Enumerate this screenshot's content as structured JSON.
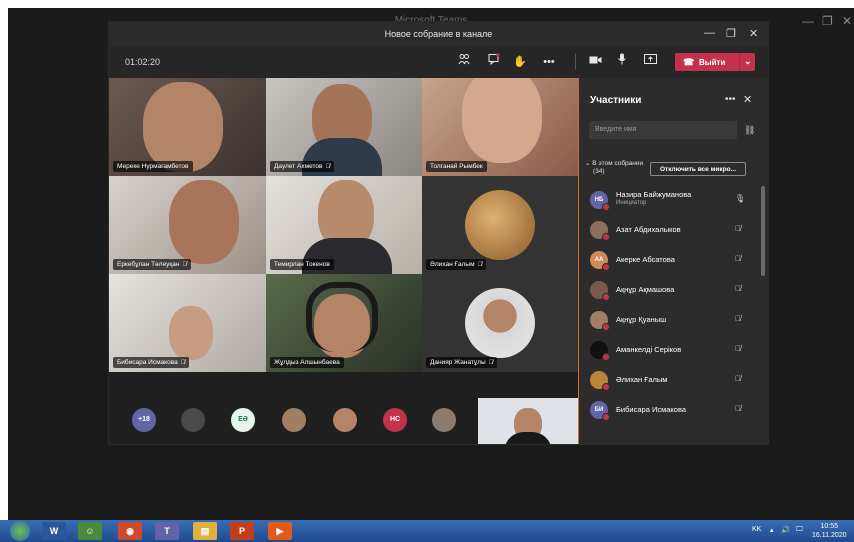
{
  "outer": {
    "title": "Microsoft Teams"
  },
  "window": {
    "title": "Новое собрание в канале"
  },
  "toolbar": {
    "timer": "01:02:20",
    "leave_label": "Выйти"
  },
  "video_tiles": [
    {
      "name": "Мереке Нурмагамбетов",
      "muted": false
    },
    {
      "name": "Даулет Ахметов",
      "muted": true
    },
    {
      "name": "Толганай Рымбек",
      "muted": false
    },
    {
      "name": "Еркебұлан Төлеуқан",
      "muted": true
    },
    {
      "name": "Темирлан Токенов",
      "muted": false
    },
    {
      "name": "Әлихан Ғалым",
      "muted": true
    },
    {
      "name": "Бибисара Исмакова",
      "muted": true
    },
    {
      "name": "Жұлдыз Алшынбаева",
      "muted": false
    },
    {
      "name": "Данияр Жанатұлы",
      "muted": true
    }
  ],
  "strip": {
    "more_count": "+18",
    "initials_eo": "ЕӘ",
    "initials_hc": "НС"
  },
  "panel": {
    "title": "Участники",
    "search_placeholder": "Введите имя",
    "section_label": "В этом собрании",
    "section_count": "(34)",
    "mute_all": "Отключить все микро...",
    "participants": [
      {
        "name": "Назира Байжуманова",
        "role": "Инициатор",
        "initials": "НБ",
        "color": "#6264a7",
        "muted": false
      },
      {
        "name": "Азат Абдихалыков",
        "role": "",
        "initials": "",
        "color": "#8a6f5a",
        "muted": true
      },
      {
        "name": "Акерке Абсатова",
        "role": "",
        "initials": "АА",
        "color": "#d08a5c",
        "muted": true
      },
      {
        "name": "Ақнұр Ақмашова",
        "role": "",
        "initials": "",
        "color": "#7a5a4a",
        "muted": true
      },
      {
        "name": "Ақнұр Қуаныш",
        "role": "",
        "initials": "",
        "color": "#a08060",
        "muted": true
      },
      {
        "name": "Аманкелді Серіков",
        "role": "",
        "initials": "",
        "color": "#1a1a1a",
        "muted": true
      },
      {
        "name": "Әлихан Ғалым",
        "role": "",
        "initials": "",
        "color": "#b8863a",
        "muted": true
      },
      {
        "name": "Бибисара Исмакова",
        "role": "",
        "initials": "БИ",
        "color": "#6264a7",
        "muted": true
      }
    ]
  },
  "tray": {
    "lang": "KK",
    "time": "10:55",
    "date": "16.11.2020"
  },
  "colors": {
    "accent": "#c4314b",
    "panel_border": "#d06d2a",
    "teams_purple": "#6264a7"
  }
}
